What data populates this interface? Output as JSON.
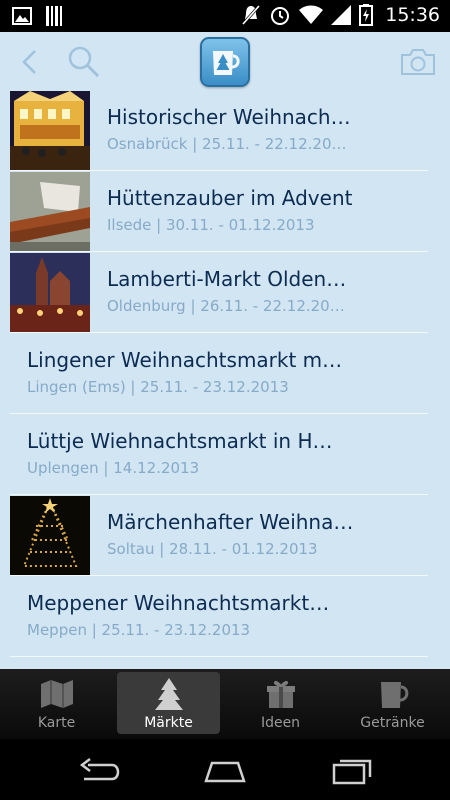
{
  "status_bar": {
    "time": "15:36",
    "icons": [
      "image-icon",
      "barcode-icon",
      "mute-icon",
      "alarm-icon",
      "wifi-icon",
      "signal-icon",
      "battery-icon"
    ]
  },
  "action_bar": {
    "icons": [
      "back-icon",
      "search-icon",
      "app-logo-icon",
      "camera-icon"
    ]
  },
  "markets": [
    {
      "title": "Historischer Weihnach…",
      "subtitle": "Osnabrück | 25.11. - 22.12.20…",
      "has_image": true,
      "image": "lit-building"
    },
    {
      "title": "Hüttenzauber im Advent",
      "subtitle": "Ilsede | 30.11. - 01.12.2013",
      "has_image": true,
      "image": "cinnamon"
    },
    {
      "title": "Lamberti-Markt Olden…",
      "subtitle": "Oldenburg | 26.11. - 22.12.20…",
      "has_image": true,
      "image": "church-market"
    },
    {
      "title": "Lingener Weihnachtsmarkt m…",
      "subtitle": "Lingen (Ems) | 25.11. - 23.12.2013",
      "has_image": false
    },
    {
      "title": "Lüttje Wiehnachtsmarkt in H…",
      "subtitle": "Uplengen | 14.12.2013",
      "has_image": false
    },
    {
      "title": "Märchenhafter Weihna…",
      "subtitle": "Soltau | 28.11. - 01.12.2013",
      "has_image": true,
      "image": "light-tree"
    },
    {
      "title": "Meppener Weihnachtsmarkt…",
      "subtitle": "Meppen | 25.11. - 23.12.2013",
      "has_image": false
    }
  ],
  "tabs": [
    {
      "label": "Karte",
      "icon": "map-icon",
      "active": false
    },
    {
      "label": "Märkte",
      "icon": "tree-icon",
      "active": true
    },
    {
      "label": "Ideen",
      "icon": "gift-icon",
      "active": false
    },
    {
      "label": "Getränke",
      "icon": "mug-icon",
      "active": false
    }
  ],
  "colors": {
    "background": "#d2e5f3",
    "title": "#0d2c52",
    "subtitle": "#86aac8",
    "accent": "#3a8ec6"
  }
}
